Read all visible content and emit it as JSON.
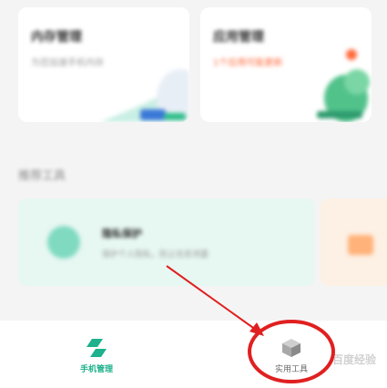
{
  "cards": [
    {
      "title": "内存管理",
      "subtitle": "为您加速手机内存"
    },
    {
      "title": "应用管理",
      "subtitle": "1个应用可能更新"
    }
  ],
  "section": {
    "title": "推荐工具",
    "tool_title": "隐私保护",
    "tool_subtitle": "保护个人隐私，防止信息泄露"
  },
  "bottom_nav": {
    "items": [
      {
        "label": "手机管理",
        "color": "#1db18c"
      },
      {
        "label": "实用工具",
        "color": "#666666"
      }
    ]
  },
  "watermark": "百度经验",
  "colors": {
    "accent": "#1db18c",
    "annotation": "#e02020",
    "badge": "#ff6a3d"
  }
}
